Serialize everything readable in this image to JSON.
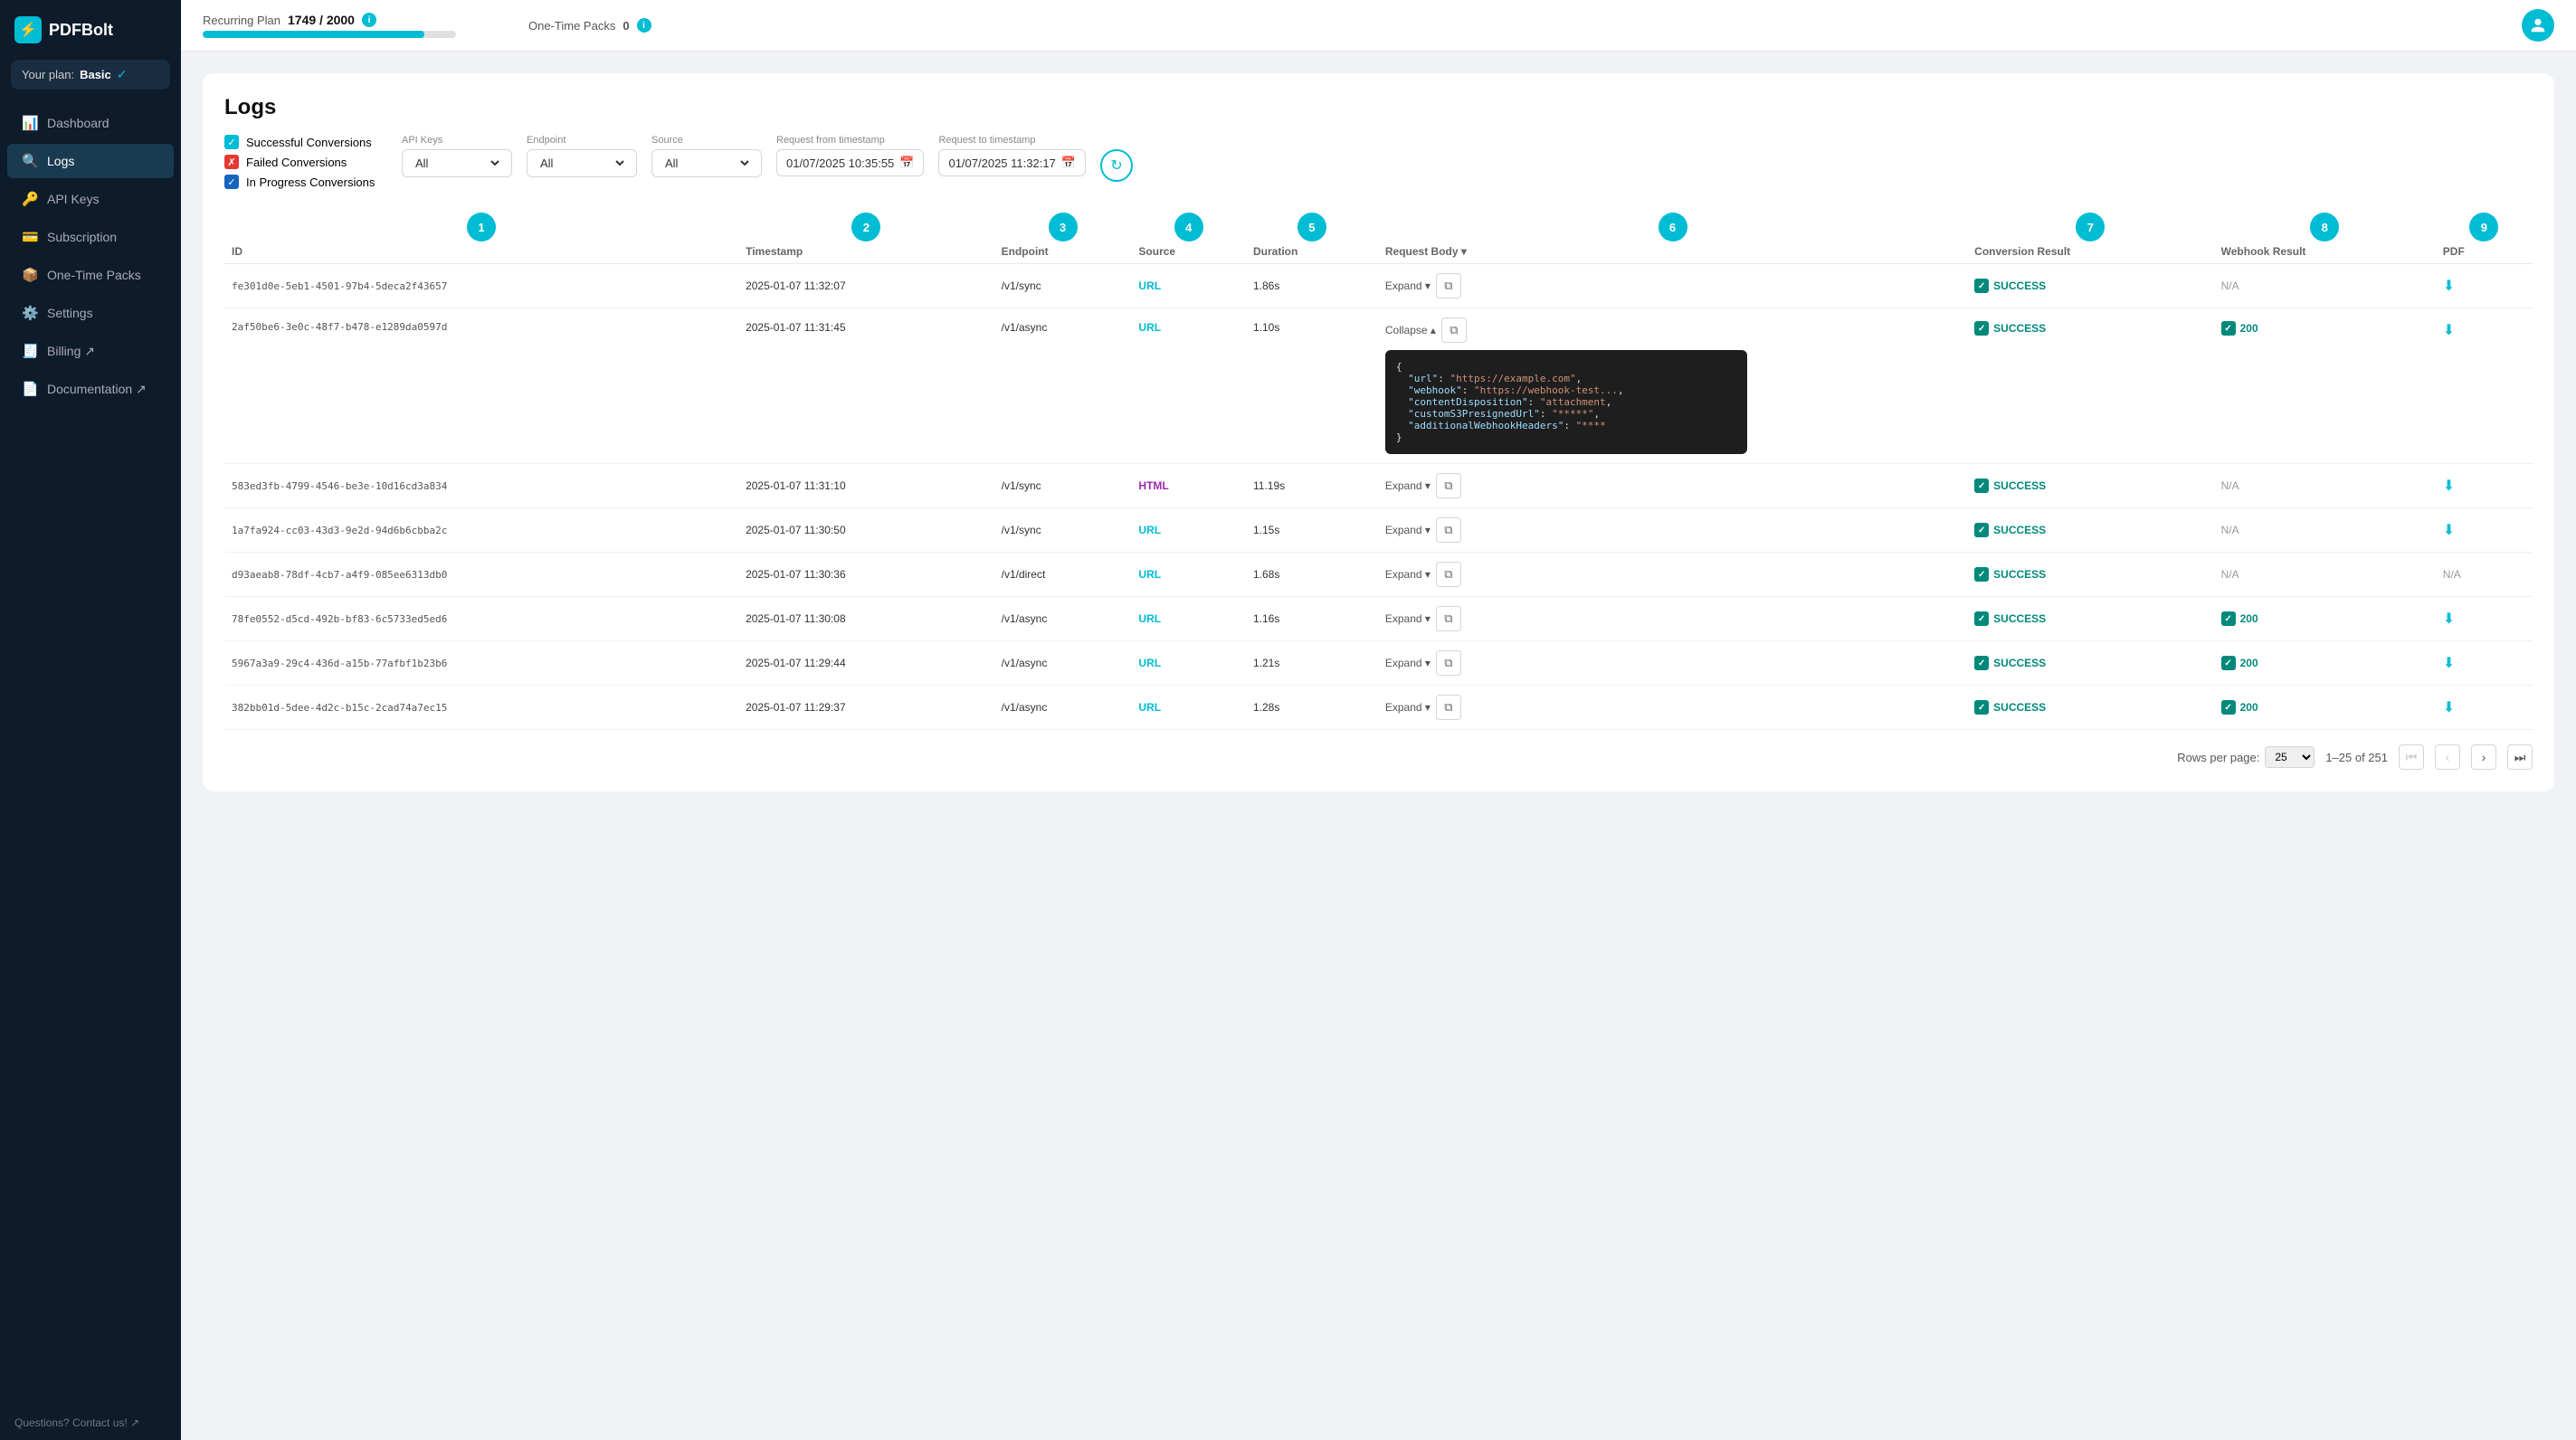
{
  "app": {
    "name": "PDFBolt",
    "logo_symbol": "⚡"
  },
  "sidebar": {
    "plan_label": "Your plan:",
    "plan_name": "Basic",
    "plan_check": "✓",
    "nav_items": [
      {
        "id": "dashboard",
        "label": "Dashboard",
        "icon": "📊",
        "active": false
      },
      {
        "id": "logs",
        "label": "Logs",
        "icon": "🔍",
        "active": true
      },
      {
        "id": "api-keys",
        "label": "API Keys",
        "icon": "🔑",
        "active": false
      },
      {
        "id": "subscription",
        "label": "Subscription",
        "icon": "💳",
        "active": false
      },
      {
        "id": "one-time-packs",
        "label": "One-Time Packs",
        "icon": "📦",
        "active": false
      },
      {
        "id": "settings",
        "label": "Settings",
        "icon": "⚙️",
        "active": false
      },
      {
        "id": "billing",
        "label": "Billing",
        "icon": "🧾",
        "active": false
      },
      {
        "id": "documentation",
        "label": "Documentation",
        "icon": "📄",
        "active": false
      }
    ],
    "contact_label": "Questions? Contact us! ↗"
  },
  "header": {
    "recurring_plan_label": "Recurring Plan",
    "usage_current": "1749",
    "usage_max": "2000",
    "usage_display": "1749 / 2000",
    "progress_percent": 87.45,
    "one_time_packs_label": "One-Time Packs",
    "one_time_packs_count": "0"
  },
  "logs": {
    "title": "Logs",
    "filters": {
      "successful_label": "Successful Conversions",
      "failed_label": "Failed Conversions",
      "in_progress_label": "In Progress Conversions",
      "api_keys_label": "API Keys",
      "api_keys_value": "All",
      "endpoint_label": "Endpoint",
      "endpoint_value": "All",
      "source_label": "Source",
      "source_value": "All",
      "request_from_label": "Request from timestamp",
      "request_from_value": "01/07/2025 10:35:55",
      "request_to_label": "Request to timestamp",
      "request_to_value": "01/07/2025 11:32:17"
    },
    "columns": [
      {
        "num": "1",
        "label": "ID"
      },
      {
        "num": "2",
        "label": "Timestamp"
      },
      {
        "num": "3",
        "label": "Endpoint"
      },
      {
        "num": "4",
        "label": "Source"
      },
      {
        "num": "5",
        "label": "Duration"
      },
      {
        "num": "6",
        "label": "Request Body"
      },
      {
        "num": "7",
        "label": "Conversion Result"
      },
      {
        "num": "8",
        "label": "Webhook Result"
      },
      {
        "num": "9",
        "label": "PDF"
      }
    ],
    "rows": [
      {
        "id": "fe301d0e-5eb1-4501-97b4-5deca2f43657",
        "timestamp": "2025-01-07 11:32:07",
        "endpoint": "/v1/sync",
        "source": "URL",
        "source_type": "url",
        "duration": "1.86s",
        "body": "expand",
        "expanded": false,
        "result": "SUCCESS",
        "webhook": "N/A",
        "pdf": "download"
      },
      {
        "id": "2af50be6-3e0c-48f7-b478-e1289da0597d",
        "timestamp": "2025-01-07 11:31:45",
        "endpoint": "/v1/async",
        "source": "URL",
        "source_type": "url",
        "duration": "1.10s",
        "body": "expanded",
        "expanded": true,
        "json_content": "{\n  \"url\": \"https://example.com\",\n  \"webhook\": \"https://webhook-test...\",\n  \"contentDisposition\": \"attachment\",\n  \"customS3PresignedUrl\": \"*****\",\n  \"additionalWebhookHeaders\": \"****\"\n}",
        "result": "SUCCESS",
        "webhook": "200",
        "pdf": "download"
      },
      {
        "id": "583ed3fb-4799-4546-be3e-10d16cd3a834",
        "timestamp": "2025-01-07 11:31:10",
        "endpoint": "/v1/sync",
        "source": "HTML",
        "source_type": "html",
        "duration": "11.19s",
        "body": "expand",
        "expanded": false,
        "result": "SUCCESS",
        "webhook": "N/A",
        "pdf": "download"
      },
      {
        "id": "1a7fa924-cc03-43d3-9e2d-94d6b6cbba2c",
        "timestamp": "2025-01-07 11:30:50",
        "endpoint": "/v1/sync",
        "source": "URL",
        "source_type": "url",
        "duration": "1.15s",
        "body": "expand",
        "expanded": false,
        "result": "SUCCESS",
        "webhook": "N/A",
        "pdf": "download"
      },
      {
        "id": "d93aeab8-78df-4cb7-a4f9-085ee6313db0",
        "timestamp": "2025-01-07 11:30:36",
        "endpoint": "/v1/direct",
        "source": "URL",
        "source_type": "url",
        "duration": "1.68s",
        "body": "expand",
        "expanded": false,
        "result": "SUCCESS",
        "webhook": "N/A",
        "pdf": "N/A"
      },
      {
        "id": "78fe0552-d5cd-492b-bf83-6c5733ed5ed6",
        "timestamp": "2025-01-07 11:30:08",
        "endpoint": "/v1/async",
        "source": "URL",
        "source_type": "url",
        "duration": "1.16s",
        "body": "expand",
        "expanded": false,
        "result": "SUCCESS",
        "webhook": "200",
        "pdf": "download"
      },
      {
        "id": "5967a3a9-29c4-436d-a15b-77afbf1b23b6",
        "timestamp": "2025-01-07 11:29:44",
        "endpoint": "/v1/async",
        "source": "URL",
        "source_type": "url",
        "duration": "1.21s",
        "body": "expand",
        "expanded": false,
        "result": "SUCCESS",
        "webhook": "200",
        "pdf": "download"
      },
      {
        "id": "382bb01d-5dee-4d2c-b15c-2cad74a7ec15",
        "timestamp": "2025-01-07 11:29:37",
        "endpoint": "/v1/async",
        "source": "URL",
        "source_type": "url",
        "duration": "1.28s",
        "body": "expand",
        "expanded": false,
        "result": "SUCCESS",
        "webhook": "200",
        "pdf": "download"
      }
    ],
    "pagination": {
      "rows_per_page_label": "Rows per page:",
      "rows_per_page": "25",
      "range": "1–25 of 251"
    }
  }
}
